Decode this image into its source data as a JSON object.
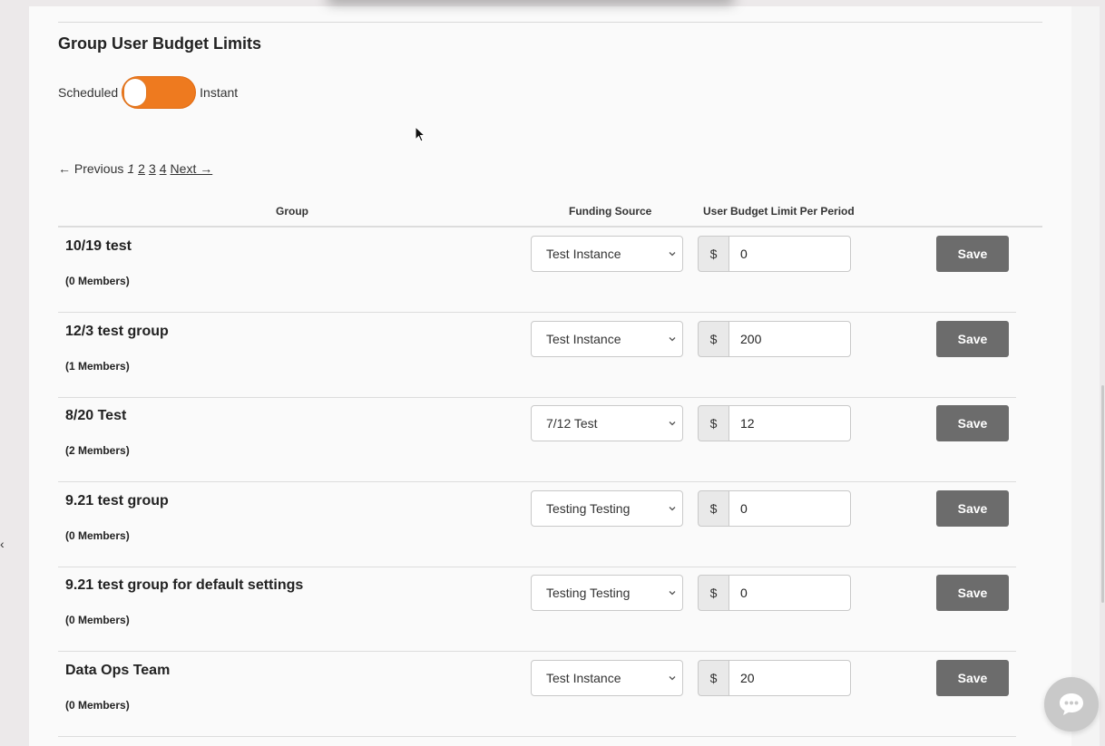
{
  "section": {
    "title": "Group User Budget Limits"
  },
  "toggle": {
    "left_label": "Scheduled",
    "right_label": "Instant"
  },
  "pagination": {
    "previous": "← Previous",
    "current": "1",
    "pages": [
      "2",
      "3",
      "4"
    ],
    "next": "Next →"
  },
  "table": {
    "headers": {
      "group": "Group",
      "funding": "Funding Source",
      "limit": "User Budget Limit Per Period"
    },
    "currency_symbol": "$",
    "save_label": "Save",
    "rows": [
      {
        "name": "10/19 test",
        "members": "(0 Members)",
        "funding": "Test Instance",
        "amount": "0"
      },
      {
        "name": "12/3 test group",
        "members": "(1 Members)",
        "funding": "Test Instance",
        "amount": "200"
      },
      {
        "name": "8/20 Test",
        "members": "(2 Members)",
        "funding": "7/12 Test",
        "amount": "12"
      },
      {
        "name": "9.21 test group",
        "members": "(0 Members)",
        "funding": "Testing Testing",
        "amount": "0"
      },
      {
        "name": "9.21 test group for default settings",
        "members": "(0 Members)",
        "funding": "Testing Testing",
        "amount": "0"
      },
      {
        "name": "Data Ops Team",
        "members": "(0 Members)",
        "funding": "Test Instance",
        "amount": "20"
      }
    ]
  },
  "colors": {
    "toggle_accent": "#ee7a1f",
    "save_button": "#6c6c6c"
  },
  "icons": {
    "chat": "chat-bubble-icon",
    "select": "chevron-down-icon"
  }
}
